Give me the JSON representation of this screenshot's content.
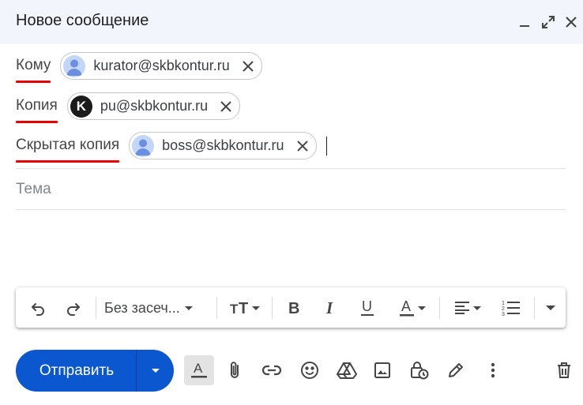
{
  "window": {
    "title": "Новое сообщение",
    "controls": [
      "minimize-icon",
      "expand-icon",
      "close-icon"
    ]
  },
  "recipients": {
    "to": {
      "label": "Кому",
      "chips": [
        {
          "email": "kurator@skbkontur.ru",
          "avatar": "person-icon"
        }
      ]
    },
    "cc": {
      "label": "Копия",
      "chips": [
        {
          "email": "pu@skbkontur.ru",
          "avatar": "K"
        }
      ]
    },
    "bcc": {
      "label": "Скрытая копия",
      "chips": [
        {
          "email": "boss@skbkontur.ru",
          "avatar": "person-icon"
        }
      ]
    }
  },
  "subject": {
    "placeholder": "Тема",
    "value": ""
  },
  "body": {
    "value": ""
  },
  "format_toolbar": {
    "font_name": "Без засеч...",
    "items": [
      "undo-icon",
      "redo-icon",
      "font-family-select",
      "text-size-icon",
      "bold-icon",
      "italic-icon",
      "underline-icon",
      "text-color-icon",
      "align-icon",
      "numbered-list-icon",
      "more-formatting-icon"
    ]
  },
  "bottom_bar": {
    "send_label": "Отправить",
    "icons": [
      "formatting-options-icon",
      "attach-icon",
      "link-icon",
      "emoji-icon",
      "drive-icon",
      "photo-icon",
      "confidential-mode-icon",
      "signature-icon",
      "more-options-icon",
      "delete-icon"
    ]
  },
  "colors": {
    "header_bg": "#f2f6fc",
    "send_button": "#0b57d0",
    "label_underline": "#e60000"
  }
}
